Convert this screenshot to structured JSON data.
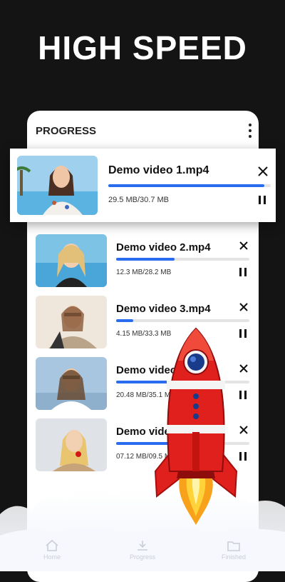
{
  "headline": "HIGH SPEED",
  "screen_title": "PROGRESS",
  "downloads": [
    {
      "title": "Demo video 1.mp4",
      "size": "29.5 MB/30.7 MB",
      "progress": 0.96
    },
    {
      "title": "Demo video 2.mp4",
      "size": "12.3 MB/28.2 MB",
      "progress": 0.44
    },
    {
      "title": "Demo video 3.mp4",
      "size": "4.15 MB/33.3 MB",
      "progress": 0.13
    },
    {
      "title": "Demo video 4.mp4",
      "size": "20.48 MB/35.1 MB",
      "progress": 0.58
    },
    {
      "title": "Demo video 5.mp4",
      "size": "07.12 MB/09.5 MB",
      "progress": 0.75
    }
  ],
  "nav": {
    "home": "Home",
    "progress": "Progress",
    "finished": "Finished"
  },
  "colors": {
    "accent": "#2a6cf0",
    "background": "#141414",
    "rocket": "#e0201c"
  }
}
